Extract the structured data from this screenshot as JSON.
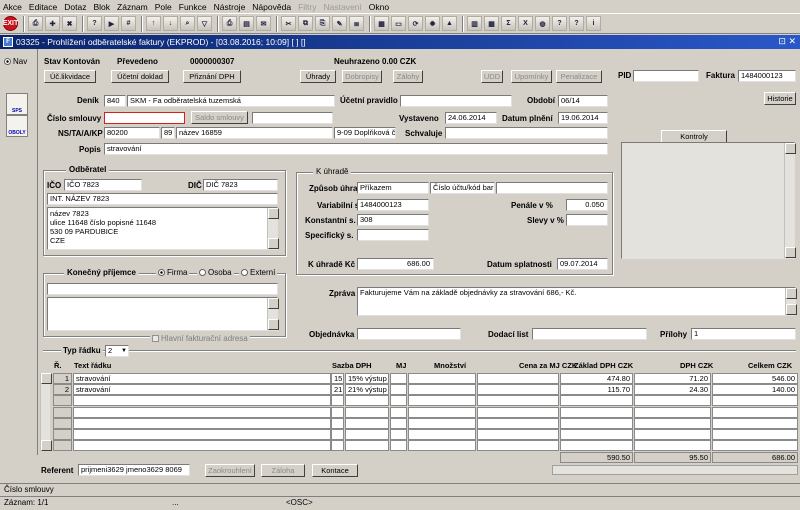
{
  "menu": [
    "Akce",
    "Editace",
    "Dotaz",
    "Blok",
    "Záznam",
    "Pole",
    "Funkce",
    "Nástroje",
    "Nápověda",
    "Filtry",
    "Nastavení",
    "Okno"
  ],
  "window": {
    "title": "03325 - Prohlížení odběratelské faktury (EKPROD) - [03.08.2016; 10:09] [ ] []",
    "controls": "⊡ ✕"
  },
  "left": {
    "nav": "Nav",
    "btn1": "SPS",
    "btn2": "OBOLY"
  },
  "header": {
    "stav_label": "Stav Kontován",
    "stav_value": "Převedeno",
    "number": "0000000307",
    "neuhrazeno": "Neuhrazeno 0.00 CZK",
    "pid_label": "PID",
    "pid_value": "",
    "faktura_label": "Faktura",
    "faktura_value": "1484000123"
  },
  "buttons": {
    "uclikvidace": "Úč.likvidace",
    "ucetnidoklad": "Účetní doklad",
    "prizanidph": "Přiznání DPH",
    "uhrady": "Úhrady",
    "dobropisy": "Dobropisy",
    "zalohy": "Zálohy",
    "udd": "UDD",
    "upominky": "Upomínky",
    "penalizace": "Penalizace",
    "historie": "Historie",
    "saldo": "Saldo smlouvy",
    "kontroly": "Kontroly",
    "zaokrouhleni": "Zaokrouhlení",
    "zaloha": "Záloha",
    "kontace": "Kontace"
  },
  "form": {
    "denik_label": "Deník",
    "denik_code": "840",
    "denik_name": "SKM - Fa odběratelská tuzemská",
    "ucetni_label": "Účetní pravidlo",
    "ucetni_value": "",
    "obdobi_label": "Období",
    "obdobi_value": "06/14",
    "cislo_label": "Číslo smlouvy",
    "cislo_value": "",
    "saldo_value": "",
    "vystaveno_label": "Vystaveno",
    "vystaveno_value": "24.06.2014",
    "plneni_label": "Datum plnění",
    "plneni_value": "19.06.2014",
    "ns_label": "NS/TA/A/KP",
    "ns1": "80200",
    "ns2": "89",
    "ns3": "název 16859",
    "ns4": "9-09 Doplňková či",
    "schvaluje_label": "Schvaluje",
    "schvaluje_value": "",
    "popis_label": "Popis",
    "popis_value": "stravování"
  },
  "odberatel": {
    "title": "Odběratel",
    "ico_label": "IČO",
    "ico_value": "IČO 7823",
    "dic_label": "DIČ",
    "dic_value": "DIČ 7823",
    "int_name": "INT. NÁZEV 7823",
    "address": [
      "název 7823",
      "ulice 11648 číslo popisné 11648",
      "530 09 PARDUBICE",
      "CZE"
    ]
  },
  "prijemce": {
    "title": "Konečný příjemce",
    "firma": "Firma",
    "osoba": "Osoba",
    "externi": "Externí",
    "hlavni": "Hlavní fakturační adresa"
  },
  "uhrada": {
    "title": "K úhradě",
    "zpusob_label": "Způsob úhrady",
    "zpusob_value": "Příkazem",
    "ucet_value": "Číslo účtu/kód bar",
    "ucet_value2": "",
    "variabilni_label": "Variabilní s.",
    "variabilni_value": "1484000123",
    "konstantni_label": "Konstantní s.",
    "konstantni_value": "308",
    "specificky_label": "Specifický s.",
    "specificky_value": "",
    "penale_label": "Penále v %",
    "penale_value": "0.050",
    "slevy_label": "Slevy v %",
    "slevy_value": "",
    "kuhrade_label": "K úhradě Kč",
    "kuhrade_value": "686.00",
    "splatnost_label": "Datum splatnosti",
    "splatnost_value": "09.07.2014"
  },
  "zprava": {
    "label": "Zpráva",
    "value": "Fakturujeme Vám  na základě objednávky za stravování 686,- Kč."
  },
  "objednavka": {
    "label": "Objednávka",
    "value": "",
    "dodaci_label": "Dodací list",
    "dodaci_value": "",
    "prilohy_label": "Přílohy",
    "prilohy_value": "1"
  },
  "typradku": {
    "label": "Typ řádku",
    "value": "2"
  },
  "table": {
    "headers": [
      "Ř.",
      "Text řádku",
      "Sazba DPH",
      "MJ",
      "Množství",
      "Cena za MJ CZK",
      "Základ DPH CZK",
      "DPH CZK",
      "Celkem CZK"
    ],
    "rows": [
      {
        "n": "1",
        "text": "stravování",
        "sazba_kod": "15",
        "sazba": "15% výstup",
        "mj": "",
        "mnozstvi": "",
        "cena": "",
        "zaklad": "474.80",
        "dph": "71.20",
        "celkem": "546.00"
      },
      {
        "n": "2",
        "text": "stravování",
        "sazba_kod": "21",
        "sazba": "21% výstup",
        "mj": "",
        "mnozstvi": "",
        "cena": "",
        "zaklad": "115.70",
        "dph": "24.30",
        "celkem": "140.00"
      }
    ],
    "totals": {
      "zaklad": "590.50",
      "dph": "95.50",
      "celkem": "686.00"
    }
  },
  "referent": {
    "label": "Referent",
    "value": "prijmeni3629 jmeno3629 8069"
  },
  "status": {
    "line1": "Číslo smlouvy",
    "line2": "Záznam: 1/1",
    "line3": "...",
    "osc": "<OSC>"
  }
}
